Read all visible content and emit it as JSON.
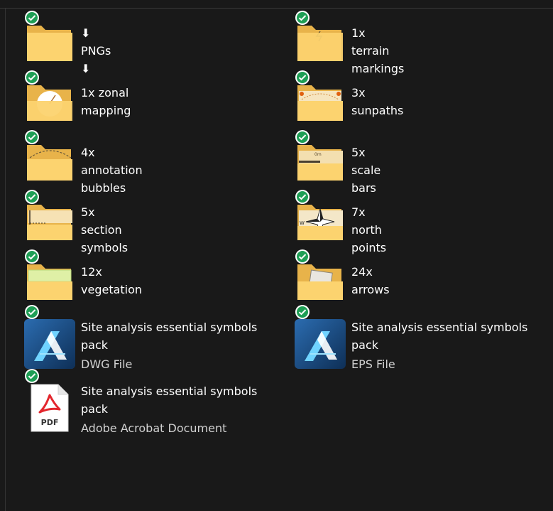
{
  "items": [
    {
      "name": "⬇ PNGs ⬇",
      "kind": "folder",
      "decor": "plain"
    },
    {
      "name": "1x terrain markings",
      "kind": "folder",
      "decor": "terrain"
    },
    {
      "name": "1x zonal mapping",
      "kind": "folder",
      "decor": "zonal"
    },
    {
      "name": "3x sunpaths",
      "kind": "folder",
      "decor": "sunpath"
    },
    {
      "name": "4x annotation bubbles",
      "kind": "folder",
      "decor": "bubble"
    },
    {
      "name": "5x scale bars",
      "kind": "folder",
      "decor": "scalebar"
    },
    {
      "name": "5x section symbols",
      "kind": "folder",
      "decor": "section"
    },
    {
      "name": "7x north points",
      "kind": "folder",
      "decor": "north"
    },
    {
      "name": "12x vegetation",
      "kind": "folder",
      "decor": "vegetation"
    },
    {
      "name": "24x arrows",
      "kind": "folder",
      "decor": "arrow"
    },
    {
      "name": "Site analysis essential symbols pack",
      "type": "DWG File",
      "kind": "affinity"
    },
    {
      "name": "Site analysis essential symbols pack",
      "type": "EPS File",
      "kind": "affinity"
    },
    {
      "name": "Site analysis essential symbols pack",
      "type": "Adobe Acrobat Document",
      "kind": "pdf"
    }
  ],
  "pdf_label": "PDF",
  "colors": {
    "background": "#191919",
    "folder_back": "#e8b34a",
    "folder_front": "#fcd36f",
    "sync_green": "#1e9e55",
    "affinity_bg": "#1b4f86",
    "pdf_red": "#e3262d"
  }
}
